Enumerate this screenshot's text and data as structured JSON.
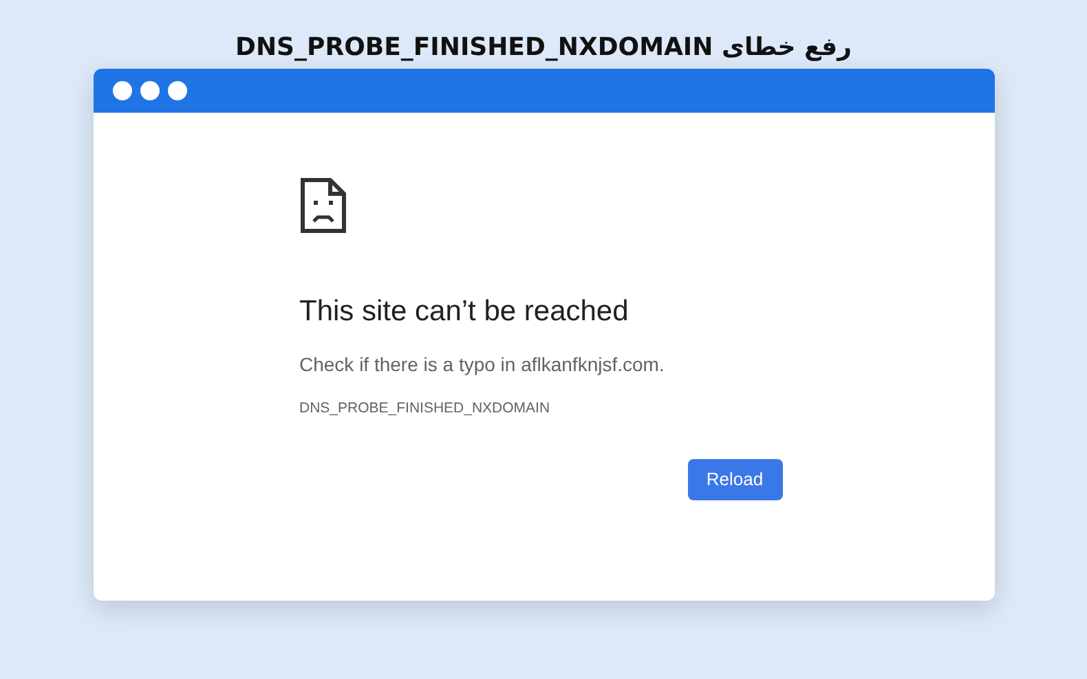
{
  "title": "رفع خطای DNS_PROBE_FINISHED_NXDOMAIN",
  "page": {
    "heading": "This site can’t be reached",
    "message": "Check if there is a typo in aflkanfknjsf.com.",
    "error_code": "DNS_PROBE_FINISHED_NXDOMAIN",
    "button": "Reload"
  }
}
